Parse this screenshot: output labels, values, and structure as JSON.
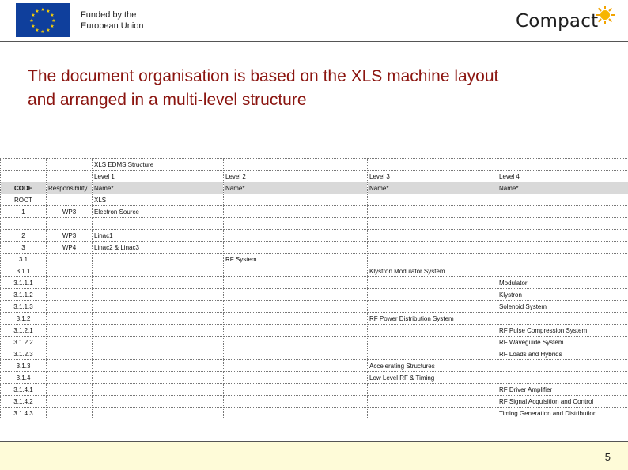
{
  "header": {
    "funded_line1": "Funded by the",
    "funded_line2": "European Union",
    "logo_text": "Compact",
    "flag_icon": "eu-flag-icon",
    "sun_icon": "sun-icon"
  },
  "title_line1": "The document organisation is based on the XLS machine layout",
  "title_line2": "and arranged in a multi-level structure",
  "table": {
    "structure_title": "XLS EDMS Structure",
    "levels": [
      "Level 1",
      "Level 2",
      "Level 3",
      "Level 4"
    ],
    "col_headers": [
      "CODE",
      "Responsibility",
      "Name*",
      "Name*",
      "Name*",
      "Name*"
    ],
    "rows": [
      {
        "code": "ROOT",
        "resp": "",
        "l1": "XLS",
        "l2": "",
        "l3": "",
        "l4": ""
      },
      {
        "code": "1",
        "resp": "WP3",
        "l1": "Electron Source",
        "l2": "",
        "l3": "",
        "l4": ""
      },
      {
        "code": "",
        "resp": "",
        "l1": "",
        "l2": "",
        "l3": "",
        "l4": ""
      },
      {
        "code": "2",
        "resp": "WP3",
        "l1": "Linac1",
        "l2": "",
        "l3": "",
        "l4": ""
      },
      {
        "code": "3",
        "resp": "WP4",
        "l1": "Linac2 & Linac3",
        "l2": "",
        "l3": "",
        "l4": ""
      },
      {
        "code": "3.1",
        "resp": "",
        "l1": "",
        "l2": "RF System",
        "l3": "",
        "l4": ""
      },
      {
        "code": "3.1.1",
        "resp": "",
        "l1": "",
        "l2": "",
        "l3": "Klystron Modulator System",
        "l4": ""
      },
      {
        "code": "3.1.1.1",
        "resp": "",
        "l1": "",
        "l2": "",
        "l3": "",
        "l4": "Modulator"
      },
      {
        "code": "3.1.1.2",
        "resp": "",
        "l1": "",
        "l2": "",
        "l3": "",
        "l4": "Klystron"
      },
      {
        "code": "3.1.1.3",
        "resp": "",
        "l1": "",
        "l2": "",
        "l3": "",
        "l4": "Solenoid System"
      },
      {
        "code": "3.1.2",
        "resp": "",
        "l1": "",
        "l2": "",
        "l3": "RF Power Distribution System",
        "l4": ""
      },
      {
        "code": "3.1.2.1",
        "resp": "",
        "l1": "",
        "l2": "",
        "l3": "",
        "l4": "RF Pulse Compression System"
      },
      {
        "code": "3.1.2.2",
        "resp": "",
        "l1": "",
        "l2": "",
        "l3": "",
        "l4": "RF Waveguide System"
      },
      {
        "code": "3.1.2.3",
        "resp": "",
        "l1": "",
        "l2": "",
        "l3": "",
        "l4": "RF Loads and Hybrids"
      },
      {
        "code": "3.1.3",
        "resp": "",
        "l1": "",
        "l2": "",
        "l3": "Accelerating Structures",
        "l4": ""
      },
      {
        "code": "3.1.4",
        "resp": "",
        "l1": "",
        "l2": "",
        "l3": "Low Level RF & Timing",
        "l4": ""
      },
      {
        "code": "3.1.4.1",
        "resp": "",
        "l1": "",
        "l2": "",
        "l3": "",
        "l4": "RF Driver Amplifier"
      },
      {
        "code": "3.1.4.2",
        "resp": "",
        "l1": "",
        "l2": "",
        "l3": "",
        "l4": "RF Signal Acquisition and Control"
      },
      {
        "code": "3.1.4.3",
        "resp": "",
        "l1": "",
        "l2": "",
        "l3": "",
        "l4": "Timing Generation and Distribution"
      }
    ]
  },
  "footer": {
    "page_number": "5"
  }
}
